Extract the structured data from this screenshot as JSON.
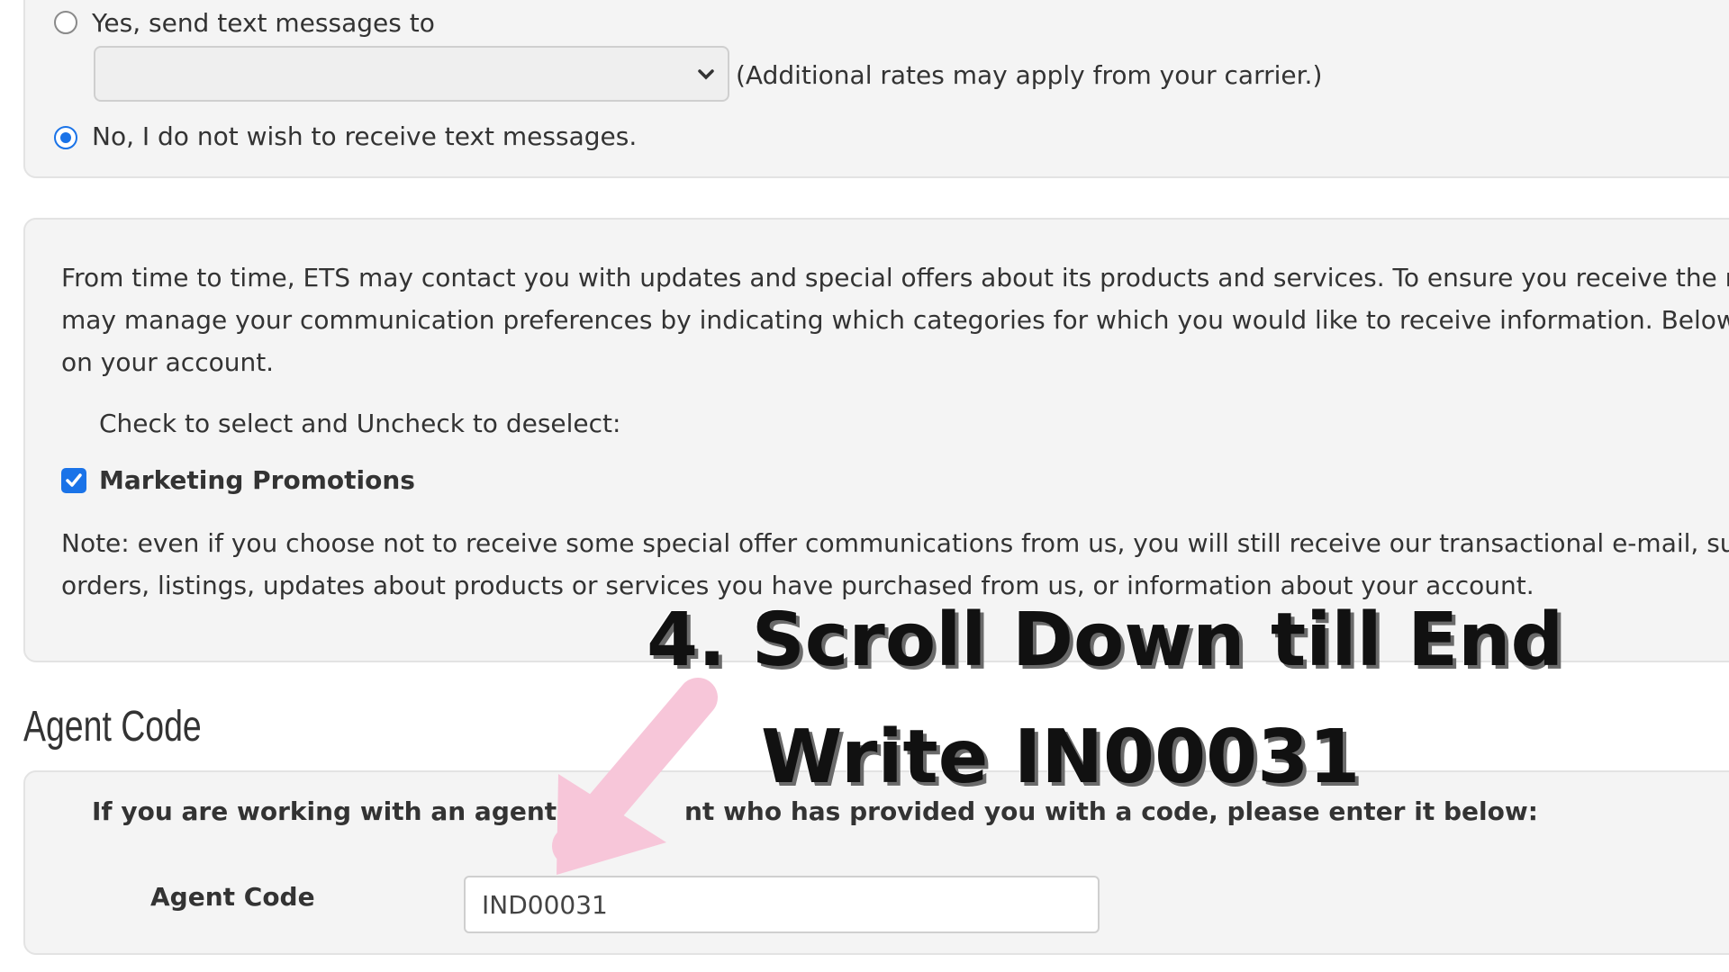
{
  "sms_options": {
    "yes_label": "Yes, send text messages to",
    "carrier_select_value": "",
    "rates_note": "(Additional rates may apply from your carrier.)",
    "no_label": "No, I do not wish to receive text messages.",
    "selected": "no"
  },
  "preferences": {
    "intro_line1": "From time to time, ETS may contact you with updates and special offers about its products and services. To ensure you receive the most r",
    "intro_line2": "may manage your communication preferences by indicating which categories for which you would like to receive information. Below are",
    "intro_line3": "on your account.",
    "instruction": "Check to select and Uncheck to deselect:",
    "marketing_label": "Marketing Promotions",
    "marketing_checked": true,
    "note_line1": "Note: even if you choose not to receive some special offer communications from us, you will still receive our transactional e-mail, such as",
    "note_line2": "orders, listings, updates about products or services you have purchased from us, or information about your account."
  },
  "agent": {
    "heading": "Agent Code",
    "prompt_before": "If you are working with an agent or c",
    "prompt_after": "nt who has provided you with a code, please enter it below:",
    "field_label": "Agent Code",
    "field_value": "IND00031"
  },
  "overlay": {
    "line1": "4. Scroll Down till End",
    "line2": "Write IN00031",
    "arrow_color": "#f7c6d9"
  }
}
